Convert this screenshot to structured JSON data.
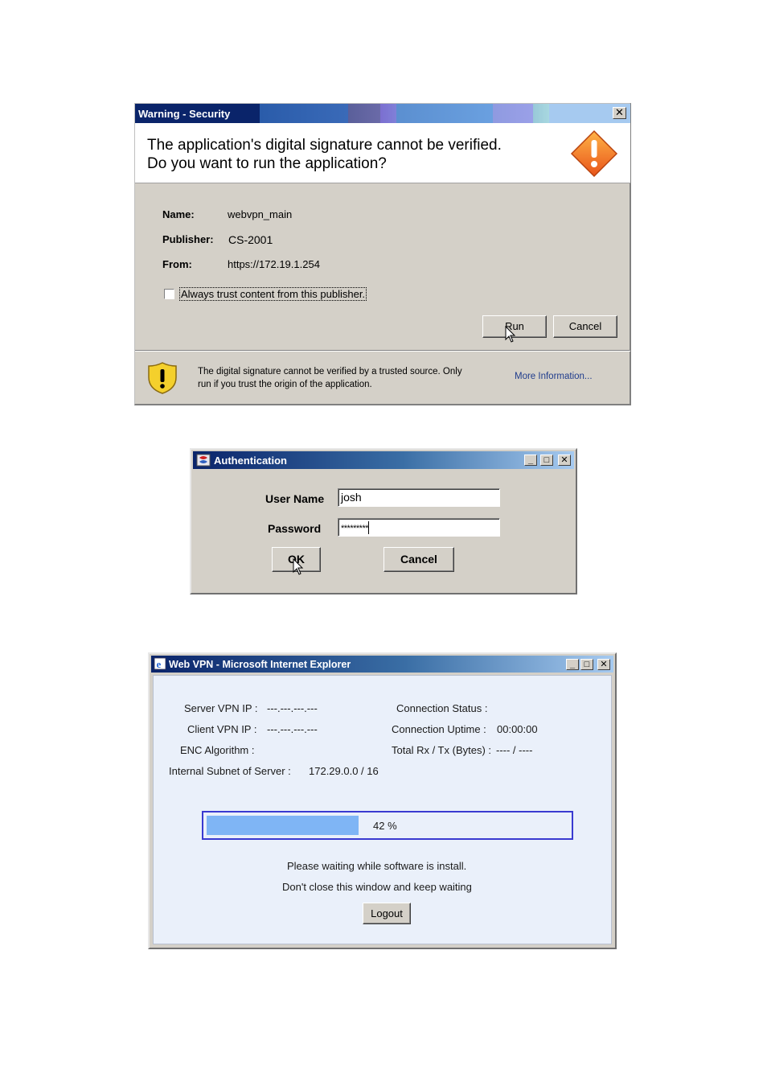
{
  "security_dialog": {
    "title": "Warning - Security",
    "headline_line1": "The application's digital signature cannot be verified.",
    "headline_line2": "Do you want to run the application?",
    "fields": {
      "name_label": "Name:",
      "name_value": "webvpn_main",
      "publisher_label": "Publisher:",
      "publisher_value": "CS-2001",
      "from_label": "From:",
      "from_value": "https://172.19.1.254"
    },
    "trust_checkbox_label": "Always trust content from this publisher.",
    "trust_checked": false,
    "run_button": "Run",
    "cancel_button": "Cancel",
    "footnote_line1": "The digital signature cannot be verified by a trusted source.  Only",
    "footnote_line2": "run if you trust the origin of the application.",
    "more_info_link": "More Information...",
    "close_glyph": "✕",
    "warning_icon": "warning-diamond-icon",
    "shield_icon": "security-shield-icon"
  },
  "auth_dialog": {
    "title": "Authentication",
    "user_name_label": "User Name",
    "user_name_value": "josh",
    "password_label": "Password",
    "password_value": "*********",
    "ok_button": "OK",
    "cancel_button": "Cancel",
    "minimize_glyph": "_",
    "maximize_glyph": "□",
    "close_glyph": "✕"
  },
  "vpn_window": {
    "title": "Web VPN - Microsoft Internet Explorer",
    "server_vpn_ip_label": "Server VPN IP :",
    "server_vpn_ip_value": "---.---.---.---",
    "client_vpn_ip_label": "Client VPN IP :",
    "client_vpn_ip_value": "---.---.---.---",
    "enc_algorithm_label": "ENC Algorithm :",
    "internal_subnet_label": "Internal Subnet of Server :",
    "internal_subnet_value": "172.29.0.0 / 16",
    "connection_status_label": "Connection Status :",
    "connection_uptime_label": "Connection Uptime :",
    "connection_uptime_value": "00:00:00",
    "total_rxtx_label": "Total Rx / Tx (Bytes) :",
    "total_rxtx_value": "---- / ----",
    "progress_percent": 42,
    "progress_text": "42 %",
    "message_line1": "Please waiting while software is install.",
    "message_line2": "Don't close this window and keep waiting",
    "logout_button": "Logout",
    "minimize_glyph": "_",
    "maximize_glyph": "□",
    "close_glyph": "✕"
  },
  "colors": {
    "titlebar_dark": "#0a246a",
    "dialog_face": "#d4d0c8",
    "progress_fill": "#7fb5f5",
    "progress_border": "#3a3ad0",
    "link": "#1f3c8c"
  }
}
